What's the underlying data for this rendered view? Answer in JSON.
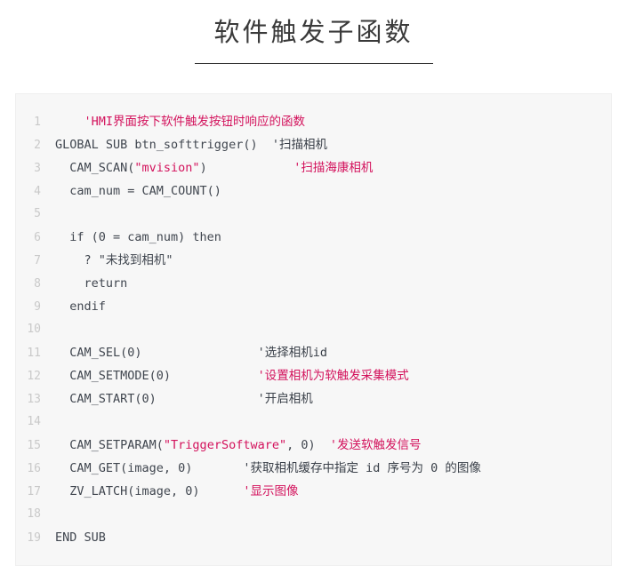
{
  "page": {
    "background": "#ffffff"
  },
  "header": {
    "title": "软件触发子函数",
    "rule_color": "#2e2e2e"
  },
  "code_block": {
    "background": "#f7f7f7",
    "border_color": "#efefef",
    "language": "basic",
    "colors": {
      "plain": "#40464f",
      "comment": "#d3125c",
      "string": "#d3125c",
      "note": "#3a4049",
      "line_number": "#c9c9c9"
    },
    "line_numbers": [
      "1",
      "2",
      "3",
      "4",
      "5",
      "6",
      "7",
      "8",
      "9",
      "10",
      "11",
      "12",
      "13",
      "14",
      "15",
      "16",
      "17",
      "18",
      "19"
    ],
    "lines": [
      {
        "number": "1",
        "tokens": [
          {
            "text": "    ",
            "type": "plain"
          },
          {
            "text": "'HMI界面按下软件触发按钮时响应的函数",
            "type": "comment"
          }
        ]
      },
      {
        "number": "2",
        "tokens": [
          {
            "text": "GLOBAL SUB btn_softtrigger()  ",
            "type": "plain"
          },
          {
            "text": "'扫描相机",
            "type": "note"
          }
        ]
      },
      {
        "number": "3",
        "tokens": [
          {
            "text": "  CAM_SCAN(",
            "type": "plain"
          },
          {
            "text": "\"mvision\"",
            "type": "string"
          },
          {
            "text": ")            ",
            "type": "plain"
          },
          {
            "text": "'扫描海康相机",
            "type": "comment"
          }
        ]
      },
      {
        "number": "4",
        "tokens": [
          {
            "text": "  cam_num = CAM_COUNT()",
            "type": "plain"
          }
        ]
      },
      {
        "number": "5",
        "tokens": [
          {
            "text": "",
            "type": "plain"
          }
        ]
      },
      {
        "number": "6",
        "tokens": [
          {
            "text": "  if (0 = cam_num) then",
            "type": "plain"
          }
        ]
      },
      {
        "number": "7",
        "tokens": [
          {
            "text": "    ? \"未找到相机\"",
            "type": "plain"
          }
        ]
      },
      {
        "number": "8",
        "tokens": [
          {
            "text": "    return",
            "type": "plain"
          }
        ]
      },
      {
        "number": "9",
        "tokens": [
          {
            "text": "  endif",
            "type": "plain"
          }
        ]
      },
      {
        "number": "10",
        "tokens": [
          {
            "text": "",
            "type": "plain"
          }
        ]
      },
      {
        "number": "11",
        "tokens": [
          {
            "text": "  CAM_SEL(0)                ",
            "type": "plain"
          },
          {
            "text": "'选择相机id",
            "type": "note"
          }
        ]
      },
      {
        "number": "12",
        "tokens": [
          {
            "text": "  CAM_SETMODE(0)            ",
            "type": "plain"
          },
          {
            "text": "'设置相机为软触发采集模式",
            "type": "comment"
          }
        ]
      },
      {
        "number": "13",
        "tokens": [
          {
            "text": "  CAM_START(0)              ",
            "type": "plain"
          },
          {
            "text": "'开启相机",
            "type": "note"
          }
        ]
      },
      {
        "number": "14",
        "tokens": [
          {
            "text": "",
            "type": "plain"
          }
        ]
      },
      {
        "number": "15",
        "tokens": [
          {
            "text": "  CAM_SETPARAM(",
            "type": "plain"
          },
          {
            "text": "\"TriggerSoftware\"",
            "type": "string"
          },
          {
            "text": ", 0)  ",
            "type": "plain"
          },
          {
            "text": "'发送软触发信号",
            "type": "comment"
          }
        ]
      },
      {
        "number": "16",
        "tokens": [
          {
            "text": "  CAM_GET(image, 0)       ",
            "type": "plain"
          },
          {
            "text": "'获取相机缓存中指定 id 序号为 0 的图像",
            "type": "note"
          }
        ]
      },
      {
        "number": "17",
        "tokens": [
          {
            "text": "  ZV_LATCH(image, 0)      ",
            "type": "plain"
          },
          {
            "text": "'显示图像",
            "type": "comment"
          }
        ]
      },
      {
        "number": "18",
        "tokens": [
          {
            "text": "",
            "type": "plain"
          }
        ]
      },
      {
        "number": "19",
        "tokens": [
          {
            "text": "END SUB",
            "type": "plain"
          }
        ]
      }
    ]
  }
}
